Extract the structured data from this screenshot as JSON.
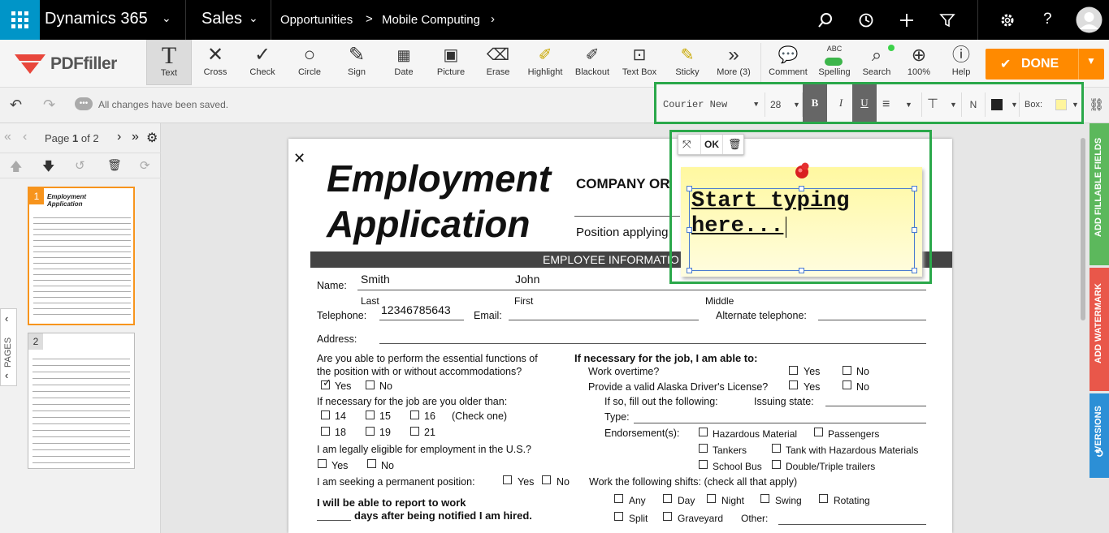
{
  "topbar": {
    "app_name": "Dynamics 365",
    "module": "Sales",
    "breadcrumb_1": "Opportunities",
    "breadcrumb_sep": ">",
    "breadcrumb_2": "Mobile Computing"
  },
  "logo": {
    "text": "PDFfiller"
  },
  "tools": {
    "text": "Text",
    "cross": "Cross",
    "check": "Check",
    "circle": "Circle",
    "sign": "Sign",
    "date": "Date",
    "picture": "Picture",
    "erase": "Erase",
    "highlight": "Highlight",
    "blackout": "Blackout",
    "textbox": "Text Box",
    "sticky": "Sticky",
    "more": "More (3)",
    "comment": "Comment",
    "spelling": "Spelling",
    "spelling_abc": "ABC",
    "search": "Search",
    "zoom": "100%",
    "help": "Help",
    "done": "DONE"
  },
  "status": {
    "saved": "All changes have been saved."
  },
  "format": {
    "font": "Courier New",
    "size": "28",
    "bold": "B",
    "italic": "I",
    "underline": "U",
    "normal": "N",
    "box_label": "Box:",
    "fill_color": "#fff59d"
  },
  "pager": {
    "label_pre": "Page",
    "current": "1",
    "label_of": "of 2"
  },
  "thumbnails": {
    "p1": "1",
    "p2": "2",
    "pages_label": "PAGES"
  },
  "sticky": {
    "ok": "OK",
    "text_line1": "Start typing",
    "text_line2": "here...",
    "color": "#fffbb0"
  },
  "doc": {
    "close": "✕",
    "title1": "Employment",
    "title2": "Application",
    "company": "COMPANY OR",
    "position": "Position applying",
    "section": "EMPLOYEE INFORMATIO",
    "name_label": "Name:",
    "last_val": "Smith",
    "first_val": "John",
    "last": "Last",
    "first": "First",
    "middle": "Middle",
    "tel_label": "Telephone:",
    "tel_val": "12346785643",
    "email_label": "Email:",
    "alt_tel": "Alternate telephone:",
    "address": "Address:",
    "q1a": "Are you able to perform the essential functions of",
    "q1b": "the position with or without accommodations?",
    "yes": "Yes",
    "no": "No",
    "q2": "If necessary for the job are you older than:",
    "a14": "14",
    "a15": "15",
    "a16": "16",
    "check_one": "(Check one)",
    "a18": "18",
    "a19": "19",
    "a21": "21",
    "q3": "I am legally eligible for employment in the U.S.?",
    "q4": "I am seeking a permanent position:",
    "q5a": "I will be able to report to work",
    "q5b": "days after being notified I am hired.",
    "r_head": "If necessary for the job, I am able to:",
    "r_overtime": "Work overtime?",
    "r_license": "Provide a valid Alaska Driver's License?",
    "r_fill": "If so, fill out the following:",
    "r_issuing": "Issuing state:",
    "r_type": "Type:",
    "r_endorse": "Endorsement(s):",
    "e1": "Hazardous Material",
    "e2": "Passengers",
    "e3": "Tankers",
    "e4": "Tank with Hazardous Materials",
    "e5": "School Bus",
    "e6": "Double/Triple trailers",
    "shifts": "Work the following shifts: (check all that apply)",
    "s_any": "Any",
    "s_day": "Day",
    "s_night": "Night",
    "s_swing": "Swing",
    "s_rot": "Rotating",
    "s_split": "Split",
    "s_grave": "Graveyard",
    "s_other": "Other:"
  },
  "rightbar": {
    "fields": "ADD FILLABLE FIELDS",
    "watermark": "ADD WATERMARK",
    "versions": "VERSIONS"
  },
  "colors": {
    "accent_blue": "#0095c8",
    "done_orange": "#ff8a00",
    "highlight_green": "#2aa84a"
  }
}
